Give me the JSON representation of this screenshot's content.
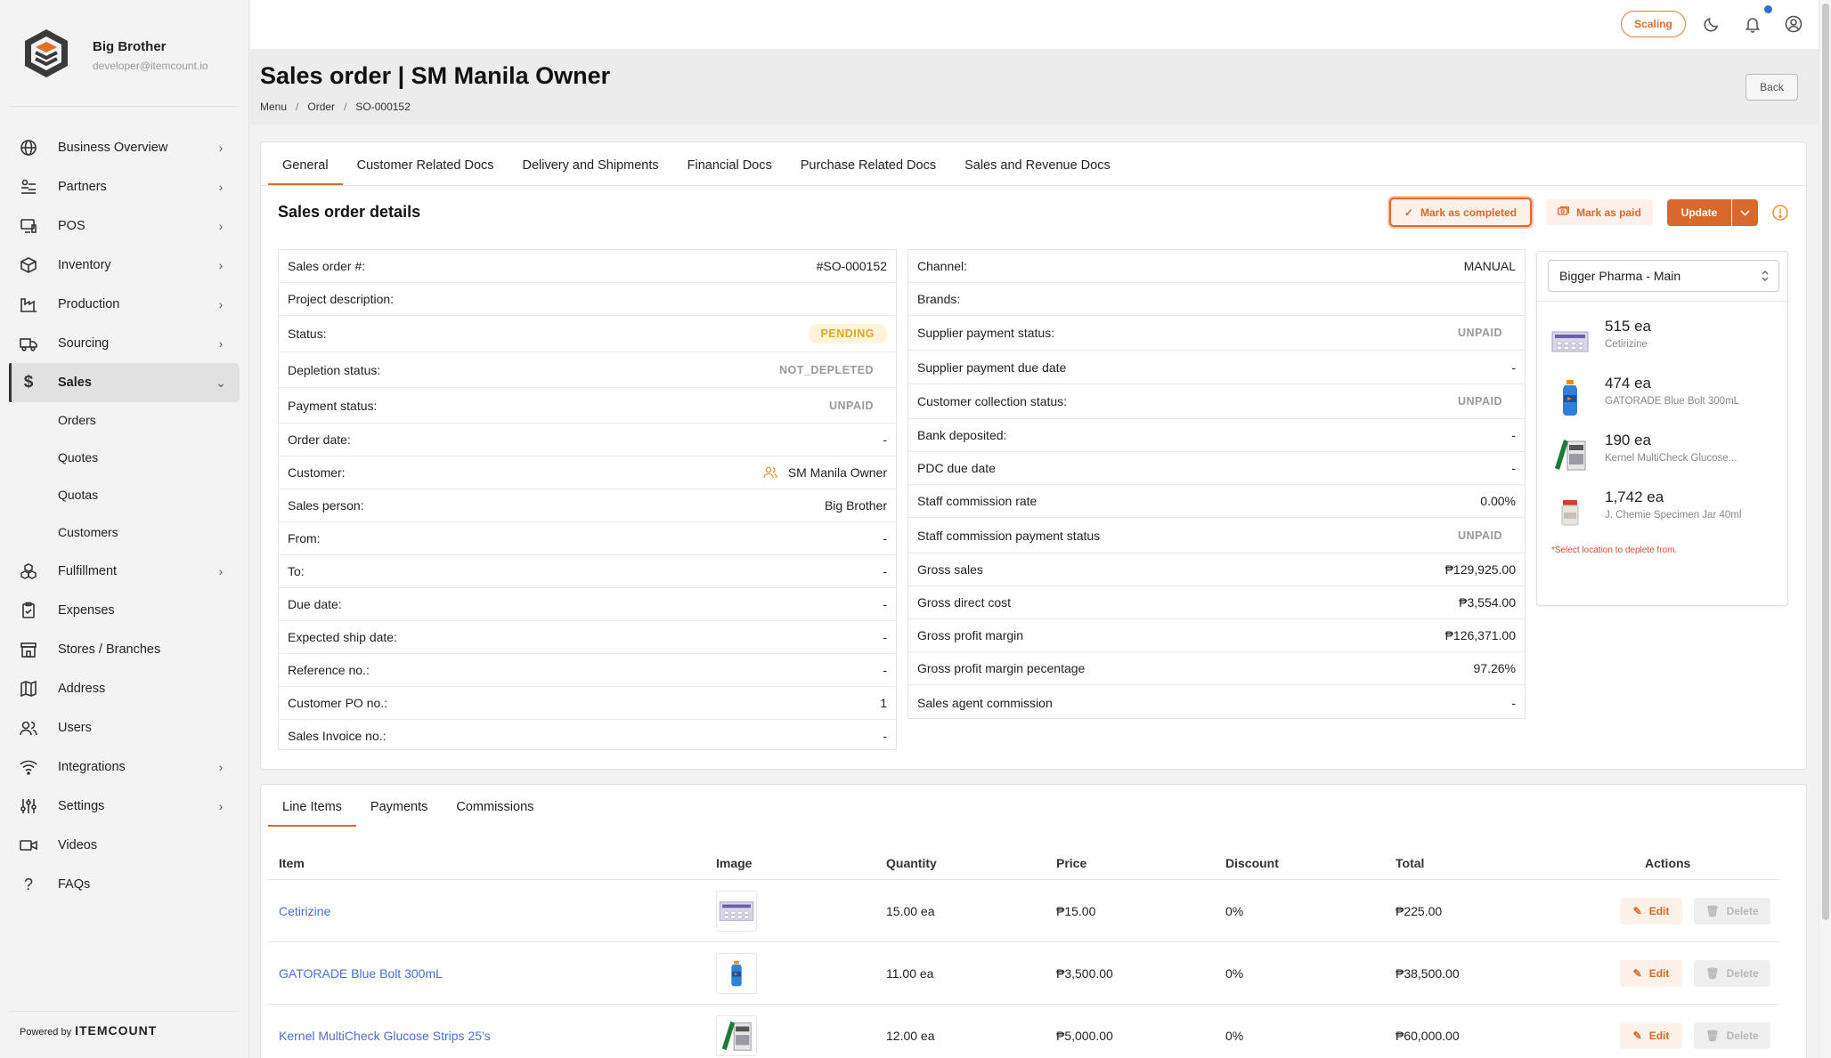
{
  "user": {
    "name": "Big Brother",
    "email": "developer@itemcount.io"
  },
  "sidebar": {
    "items": [
      {
        "label": "Business Overview",
        "icon": "globe-icon",
        "chevron": true
      },
      {
        "label": "Partners",
        "icon": "partners-icon",
        "chevron": true
      },
      {
        "label": "POS",
        "icon": "pos-icon",
        "chevron": true
      },
      {
        "label": "Inventory",
        "icon": "box-icon",
        "chevron": true
      },
      {
        "label": "Production",
        "icon": "factory-icon",
        "chevron": true
      },
      {
        "label": "Sourcing",
        "icon": "truck-icon",
        "chevron": true
      },
      {
        "label": "Sales",
        "icon": "dollar-icon",
        "chevron": true,
        "active": true
      },
      {
        "label": "Fulfillment",
        "icon": "boxes-icon",
        "chevron": true
      },
      {
        "label": "Expenses",
        "icon": "clipboard-icon",
        "chevron": false
      },
      {
        "label": "Stores / Branches",
        "icon": "store-icon",
        "chevron": false
      },
      {
        "label": "Address",
        "icon": "map-icon",
        "chevron": false
      },
      {
        "label": "Users",
        "icon": "users-icon",
        "chevron": false
      },
      {
        "label": "Integrations",
        "icon": "wifi-icon",
        "chevron": true
      },
      {
        "label": "Settings",
        "icon": "sliders-icon",
        "chevron": true
      },
      {
        "label": "Videos",
        "icon": "video-icon",
        "chevron": false
      },
      {
        "label": "FAQs",
        "icon": "question-icon",
        "chevron": false
      }
    ],
    "sales_sub": [
      "Orders",
      "Quotes",
      "Quotas",
      "Customers"
    ],
    "powered_by": "Powered by",
    "powered_brand": "ITEMCOUNT"
  },
  "topbar": {
    "scaling_label": "Scaling"
  },
  "header": {
    "title": "Sales order | SM Manila Owner",
    "breadcrumb": [
      "Menu",
      "Order",
      "SO-000152"
    ],
    "back_label": "Back"
  },
  "tabs": [
    "General",
    "Customer Related Docs",
    "Delivery and Shipments",
    "Financial Docs",
    "Purchase Related Docs",
    "Sales and Revenue Docs"
  ],
  "details": {
    "title": "Sales order details",
    "mark_completed": "Mark as completed",
    "mark_paid": "Mark as paid",
    "update": "Update",
    "left": [
      {
        "k": "Sales order #:",
        "v": "#SO-000152"
      },
      {
        "k": "Project description:",
        "v": ""
      },
      {
        "k": "Status:",
        "v": "PENDING",
        "type": "pill"
      },
      {
        "k": "Depletion status:",
        "v": "NOT_DEPLETED",
        "type": "muted"
      },
      {
        "k": "Payment status:",
        "v": "UNPAID",
        "type": "muted"
      },
      {
        "k": "Order date:",
        "v": "-"
      },
      {
        "k": "Customer:",
        "v": "SM Manila Owner",
        "type": "customer"
      },
      {
        "k": "Sales person:",
        "v": "Big Brother"
      },
      {
        "k": "From:",
        "v": "-"
      },
      {
        "k": "To:",
        "v": "-"
      },
      {
        "k": "Due date:",
        "v": "-"
      },
      {
        "k": "Expected ship date:",
        "v": "-"
      },
      {
        "k": "Reference no.:",
        "v": "-"
      },
      {
        "k": "Customer PO no.:",
        "v": "1"
      },
      {
        "k": "Sales Invoice no.:",
        "v": "-"
      }
    ],
    "right": [
      {
        "k": "Channel:",
        "v": "MANUAL"
      },
      {
        "k": "Brands:",
        "v": ""
      },
      {
        "k": "Supplier payment status:",
        "v": "UNPAID",
        "type": "muted"
      },
      {
        "k": "Supplier payment due date",
        "v": "-"
      },
      {
        "k": "Customer collection status:",
        "v": "UNPAID",
        "type": "muted"
      },
      {
        "k": "Bank deposited:",
        "v": "-"
      },
      {
        "k": "PDC due date",
        "v": "-"
      },
      {
        "k": "Staff commission rate",
        "v": "0.00%"
      },
      {
        "k": "Staff commission payment status",
        "v": "UNPAID",
        "type": "muted"
      },
      {
        "k": "Gross sales",
        "v": "₱129,925.00"
      },
      {
        "k": "Gross direct cost",
        "v": "₱3,554.00"
      },
      {
        "k": "Gross profit margin",
        "v": "₱126,371.00"
      },
      {
        "k": "Gross profit margin pecentage",
        "v": "97.26%"
      },
      {
        "k": "Sales agent commission",
        "v": "-"
      }
    ]
  },
  "stock": {
    "location": "Bigger Pharma - Main",
    "items": [
      {
        "qty": "515 ea",
        "name": "Cetirizine"
      },
      {
        "qty": "474 ea",
        "name": "GATORADE Blue Bolt 300mL"
      },
      {
        "qty": "190 ea",
        "name": "Kernel MultiCheck Glucose..."
      },
      {
        "qty": "1,742 ea",
        "name": "J. Chemie Specimen Jar 40ml"
      }
    ],
    "note": "*Select location to deplete from."
  },
  "line_items": {
    "tabs": [
      "Line Items",
      "Payments",
      "Commissions"
    ],
    "headers": [
      "Item",
      "Image",
      "Quantity",
      "Price",
      "Discount",
      "Total",
      "Actions"
    ],
    "rows": [
      {
        "item": "Cetirizine",
        "qty": "15.00 ea",
        "price": "₱15.00",
        "discount": "0%",
        "total": "₱225.00"
      },
      {
        "item": "GATORADE Blue Bolt 300mL",
        "qty": "11.00 ea",
        "price": "₱3,500.00",
        "discount": "0%",
        "total": "₱38,500.00"
      },
      {
        "item": "Kernel MultiCheck Glucose Strips 25's",
        "qty": "12.00 ea",
        "price": "₱5,000.00",
        "discount": "0%",
        "total": "₱60,000.00"
      }
    ],
    "edit_label": "Edit",
    "delete_label": "Delete"
  }
}
